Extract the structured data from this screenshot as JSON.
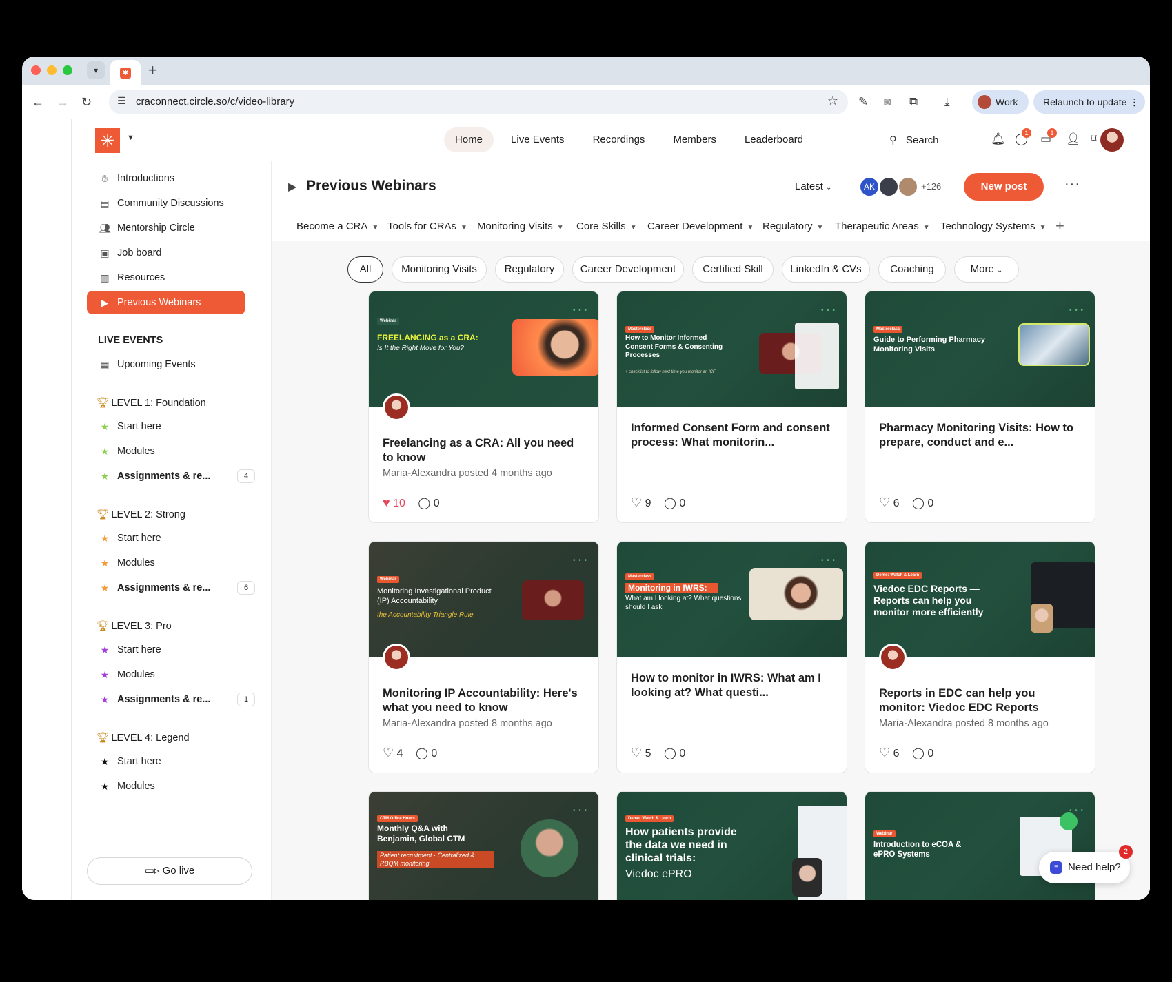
{
  "browser": {
    "url": "craconnect.circle.so/c/video-library",
    "profile": "Work",
    "relaunch": "Relaunch to update"
  },
  "topnav": {
    "items": [
      "Home",
      "Live Events",
      "Recordings",
      "Members",
      "Leaderboard"
    ],
    "active": "Home",
    "search": "Search",
    "chat_badge": "1",
    "dm_badge": "1"
  },
  "sidebar": {
    "spaces": [
      "Introductions",
      "Community Discussions",
      "Mentorship Circle",
      "Job board",
      "Resources",
      "Previous Webinars"
    ],
    "live_events_heading": "LIVE EVENTS",
    "upcoming": "Upcoming Events",
    "levels": [
      {
        "title": "LEVEL 1: Foundation",
        "items": [
          "Start here",
          "Modules",
          "Assignments & re..."
        ],
        "count": "4",
        "star_color": "#8fd14f"
      },
      {
        "title": "LEVEL 2: Strong",
        "items": [
          "Start here",
          "Modules",
          "Assignments & re..."
        ],
        "count": "6",
        "star_color": "#f29b38"
      },
      {
        "title": "LEVEL 3: Pro",
        "items": [
          "Start here",
          "Modules",
          "Assignments & re..."
        ],
        "count": "1",
        "star_color": "#a23fd8"
      },
      {
        "title": "LEVEL 4: Legend",
        "items": [
          "Start here",
          "Modules"
        ],
        "count": "",
        "star_color": "#111111"
      }
    ],
    "golive": "Go live"
  },
  "space": {
    "title": "Previous Webinars",
    "sort": "Latest",
    "member_initials": "AK",
    "member_count": "+126",
    "new_post": "New post"
  },
  "topics": [
    "Become a CRA",
    "Tools for CRAs",
    "Monitoring Visits",
    "Core Skills",
    "Career Development",
    "Regulatory",
    "Therapeutic Areas",
    "Technology Systems"
  ],
  "filters": [
    "All",
    "Monitoring Visits",
    "Regulatory",
    "Career Development",
    "Certified Skill",
    "LinkedIn & CVs",
    "Coaching",
    "More"
  ],
  "cards": [
    {
      "thumb_tag": "Webinar",
      "thumb_title": "FREELANCING as a CRA:",
      "thumb_sub": "Is It the Right Move for You?",
      "title": "Freelancing as a CRA: All you need to know",
      "meta": "Maria-Alexandra posted 4 months ago",
      "likes": "10",
      "comments": "0",
      "liked": true
    },
    {
      "thumb_tag": "Masterclass",
      "thumb_title": "How to Monitor Informed Consent Forms & Consenting Processes",
      "thumb_sub": "+ checklist to follow next time you monitor an ICF",
      "title": "Informed Consent Form and consent process: What monitorin...",
      "meta": "",
      "likes": "9",
      "comments": "0",
      "liked": false
    },
    {
      "thumb_tag": "Masterclass",
      "thumb_title": "Guide to Performing Pharmacy Monitoring Visits",
      "thumb_sub": "",
      "title": "Pharmacy Monitoring Visits: How to prepare, conduct and e...",
      "meta": "",
      "likes": "6",
      "comments": "0",
      "liked": false
    },
    {
      "thumb_tag": "Webinar",
      "thumb_title": "Monitoring Investigational Product (IP) Accountability",
      "thumb_sub": "the Accountability Triangle Rule",
      "title": "Monitoring IP Accountability: Here's what you need to know",
      "meta": "Maria-Alexandra posted 8 months ago",
      "likes": "4",
      "comments": "0",
      "liked": false
    },
    {
      "thumb_tag": "Masterclass",
      "thumb_title": "Monitoring in IWRS:",
      "thumb_sub": "What am I looking at? What questions should I ask",
      "title": "How to monitor in IWRS: What am I looking at? What questi...",
      "meta": "",
      "likes": "5",
      "comments": "0",
      "liked": false
    },
    {
      "thumb_tag": "Demo: Watch & Learn",
      "thumb_title": "Viedoc EDC Reports — Reports can help you monitor more efficiently",
      "thumb_sub": "",
      "title": "Reports in EDC can help you monitor: Viedoc EDC Reports",
      "meta": "Maria-Alexandra posted 8 months ago",
      "likes": "6",
      "comments": "0",
      "liked": false
    },
    {
      "thumb_tag": "CTM Office Hours",
      "thumb_title": "Monthly Q&A with Benjamin, Global CTM",
      "thumb_sub": "Patient recruitment · Centralized & RBQM monitoring",
      "title": "",
      "meta": "",
      "likes": "",
      "comments": "",
      "liked": false
    },
    {
      "thumb_tag": "Demo: Watch & Learn",
      "thumb_title": "How patients provide the data we need in clinical trials:",
      "thumb_sub": "Viedoc ePRO",
      "title": "",
      "meta": "",
      "likes": "",
      "comments": "",
      "liked": false
    },
    {
      "thumb_tag": "Webinar",
      "thumb_title": "Introduction to eCOA & ePRO Systems",
      "thumb_sub": "",
      "title": "",
      "meta": "",
      "likes": "",
      "comments": "",
      "liked": false
    }
  ],
  "help": {
    "label": "Need help?",
    "badge": "2"
  }
}
